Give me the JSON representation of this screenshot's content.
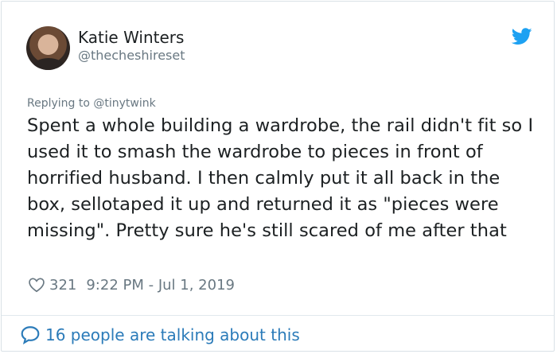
{
  "author": {
    "name": "Katie Winters",
    "handle": "@thecheshireset"
  },
  "tweet": {
    "replying_to": "Replying to @tinytwink",
    "text": "Spent a whole building a wardrobe, the rail didn't fit so I used it to smash the wardrobe to pieces in front of horrified husband. I then calmly put it all back in the box, sellotaped it up and returned it as \"pieces were missing\". Pretty sure he's still scared of me after that",
    "likes": "321",
    "timestamp": "9:22 PM - Jul 1, 2019"
  },
  "footer": {
    "talking": "16 people are talking about this"
  },
  "colors": {
    "twitter_blue": "#1da1f2",
    "link_blue": "#2b7bb9",
    "text": "#1c2022",
    "muted": "#697882"
  },
  "icons": [
    "twitter-bird-icon",
    "heart-icon",
    "comment-bubble-icon"
  ]
}
